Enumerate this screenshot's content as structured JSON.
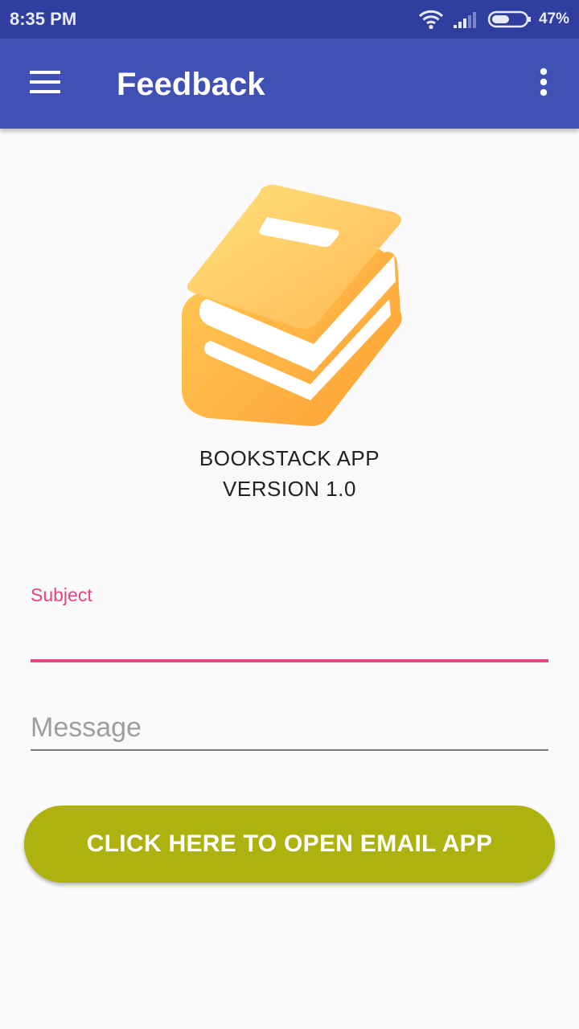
{
  "status_bar": {
    "time": "8:35 PM",
    "battery_percent": "47%",
    "icons": [
      "wifi-icon",
      "cell-signal-icon",
      "battery-icon"
    ]
  },
  "app_bar": {
    "title": "Feedback",
    "menu_icon": "hamburger-menu-icon",
    "overflow_icon": "more-vert-icon"
  },
  "about": {
    "logo_icon": "book-stack-icon",
    "app_name": "BOOKSTACK APP",
    "version": "VERSION 1.0"
  },
  "form": {
    "subject_label": "Subject",
    "subject_value": "",
    "message_placeholder": "Message",
    "message_value": ""
  },
  "actions": {
    "open_email_label": "CLICK HERE TO OPEN EMAIL APP"
  },
  "colors": {
    "status_bar": "#303f9f",
    "app_bar": "#3f51b5",
    "accent": "#e8437e",
    "button": "#adb20e",
    "background": "#fafafa"
  }
}
